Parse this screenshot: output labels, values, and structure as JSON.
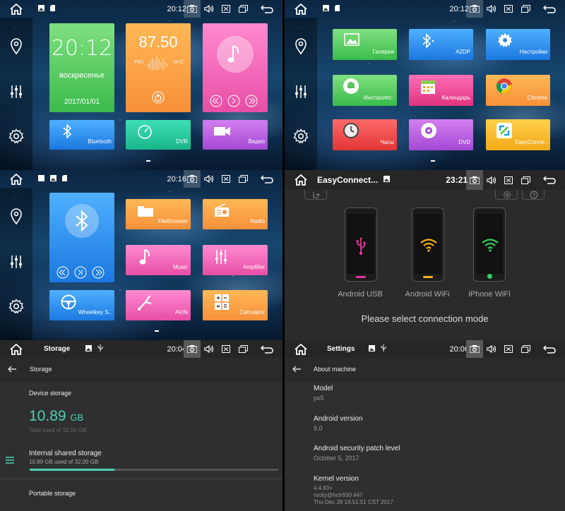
{
  "q1": {
    "time": "20:12",
    "clock": {
      "time": "20:12",
      "day": "воскресенье",
      "date": "2017/01/01"
    },
    "radio": {
      "freq": "87.50",
      "fm": "FM1",
      "unit": "MHZ"
    },
    "tiles": [
      {
        "label": "Bluetooth"
      },
      {
        "label": "DVR"
      },
      {
        "label": "Видео"
      }
    ]
  },
  "q2": {
    "time": "20:12",
    "tiles": [
      {
        "label": "Галерея"
      },
      {
        "label": "A2DP"
      },
      {
        "label": "Настройки"
      },
      {
        "label": "Инсталлят.."
      },
      {
        "label": "Календарь"
      },
      {
        "label": "Chrome"
      },
      {
        "label": "Часы"
      },
      {
        "label": "DVD"
      },
      {
        "label": "EasyConne.."
      }
    ]
  },
  "q3": {
    "time": "20:16",
    "tiles": [
      {
        "label": "FileBrowser"
      },
      {
        "label": "Radio"
      },
      {
        "label": "Music"
      },
      {
        "label": "Amplifier"
      },
      {
        "label": "Wheelkey S.."
      },
      {
        "label": "AVIN"
      },
      {
        "label": "Calculator"
      }
    ]
  },
  "q4": {
    "title": "EasyConnect...",
    "time": "23:21",
    "modes": [
      {
        "label": "Android USB"
      },
      {
        "label": "Android WiFi"
      },
      {
        "label": "iPhone WiFi"
      }
    ],
    "prompt": "Please select connection mode"
  },
  "q5": {
    "app": "Storage",
    "time": "20:04",
    "header": "Storage",
    "device_storage": "Device storage",
    "used_value": "10.89",
    "used_unit": "GB",
    "total_used": "Total used of 32.00 GB",
    "internal_title": "Internal shared storage",
    "internal_sub": "10.89 GB used of 32.00 GB",
    "internal_fraction": 0.34,
    "portable": "Portable storage"
  },
  "q6": {
    "app": "Settings",
    "time": "20:06",
    "header": "About machine",
    "items": [
      {
        "title": "Model",
        "value": "px5"
      },
      {
        "title": "Android version",
        "value": "9.0"
      },
      {
        "title": "Android security patch level",
        "value": "October 5, 2017"
      },
      {
        "title": "Kernel version",
        "value": "4.4.93+",
        "value2": "rocky@hctr930 #47",
        "value3": "Thu Dec 28 14:51:51 CST 2017"
      }
    ]
  },
  "colors": {
    "accent": "#4dd0b8",
    "cam_highlight": "#5a5a5a"
  }
}
